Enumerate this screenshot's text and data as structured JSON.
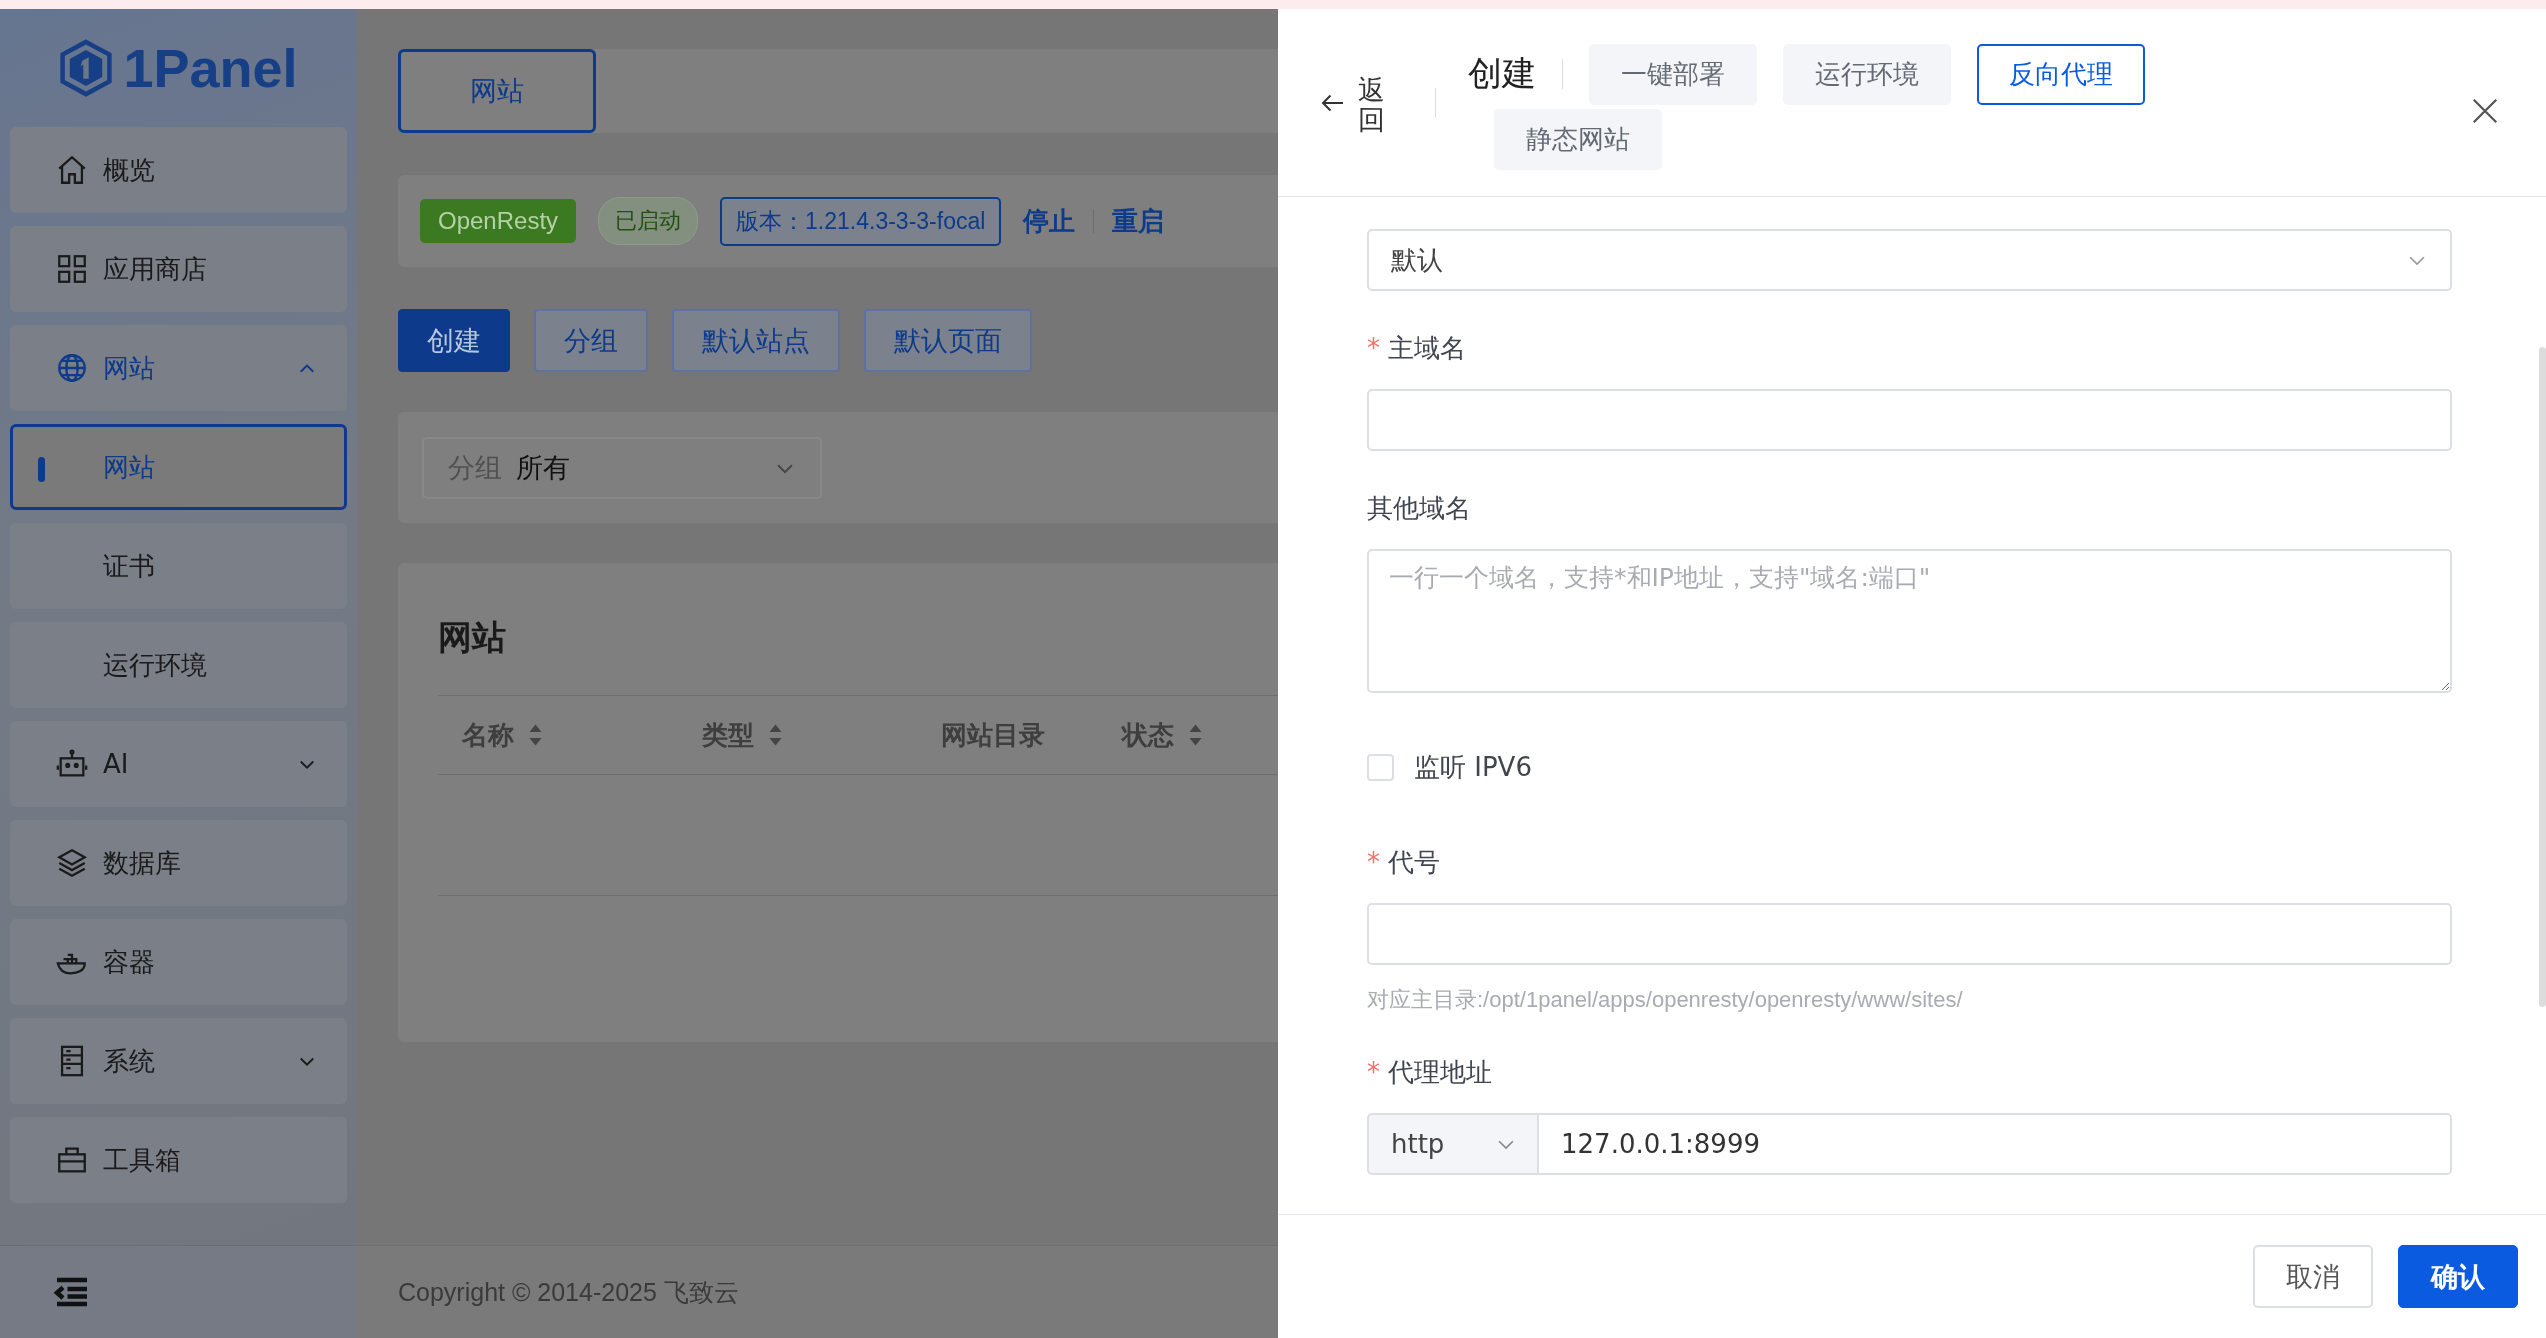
{
  "sidebar": {
    "logo": "1Panel",
    "menu": [
      {
        "label": "概览",
        "selected": false
      },
      {
        "label": "应用商店",
        "selected": false
      },
      {
        "label": "网站",
        "selected": true,
        "expanded": true,
        "children": [
          {
            "label": "网站",
            "selected": true
          },
          {
            "label": "证书",
            "selected": false
          },
          {
            "label": "运行环境",
            "selected": false
          }
        ]
      },
      {
        "label": "AI",
        "selected": false,
        "expanded": false
      },
      {
        "label": "数据库",
        "selected": false
      },
      {
        "label": "容器",
        "selected": false
      },
      {
        "label": "系统",
        "selected": false,
        "expanded": false
      },
      {
        "label": "工具箱",
        "selected": false
      }
    ]
  },
  "page_tabs": [
    {
      "label": "网站",
      "selected": true
    }
  ],
  "app_status": {
    "app": "OpenResty",
    "state": "已启动",
    "version": "版本：1.21.4.3-3-3-focal",
    "actions": [
      "停止",
      "重启"
    ]
  },
  "toolbar": [
    {
      "label": "创建",
      "kind": "primary"
    },
    {
      "label": "分组",
      "kind": "plain"
    },
    {
      "label": "默认站点",
      "kind": "plain"
    },
    {
      "label": "默认页面",
      "kind": "plain"
    }
  ],
  "filter": {
    "label": "分组",
    "value": "所有"
  },
  "table": {
    "title": "网站",
    "columns": [
      {
        "label": "名称",
        "sortable": true
      },
      {
        "label": "类型",
        "sortable": true
      },
      {
        "label": "网站目录",
        "sortable": false
      },
      {
        "label": "状态",
        "sortable": true
      }
    ]
  },
  "footer": {
    "copyright": "Copyright © 2014-2025 飞致云"
  },
  "drawer": {
    "back": "返回",
    "title": "创建",
    "required_mark": "*",
    "types": [
      {
        "label": "一键部署",
        "selected": false
      },
      {
        "label": "运行环境",
        "selected": false
      },
      {
        "label": "反向代理",
        "selected": true
      },
      {
        "label": "静态网站",
        "selected": false
      }
    ],
    "fields": [
      {
        "kind": "select",
        "value": "默认"
      },
      {
        "kind": "input",
        "label": "主域名",
        "required": true
      },
      {
        "kind": "textarea",
        "label": "其他域名",
        "required": false,
        "placeholder": "一行一个域名，支持*和IP地址，支持\"域名:端口\""
      },
      {
        "kind": "checkbox",
        "label": "监听 IPV6",
        "checked": false
      },
      {
        "kind": "input",
        "label": "代号",
        "required": true,
        "hint": "对应主目录:/opt/1panel/apps/openresty/openresty/www/sites/"
      },
      {
        "kind": "proxy",
        "label": "代理地址",
        "required": true,
        "scheme": "http",
        "value": "127.0.0.1:8999"
      }
    ],
    "buttons": [
      {
        "label": "取消",
        "kind": "plain"
      },
      {
        "label": "确认",
        "kind": "primary"
      }
    ]
  }
}
